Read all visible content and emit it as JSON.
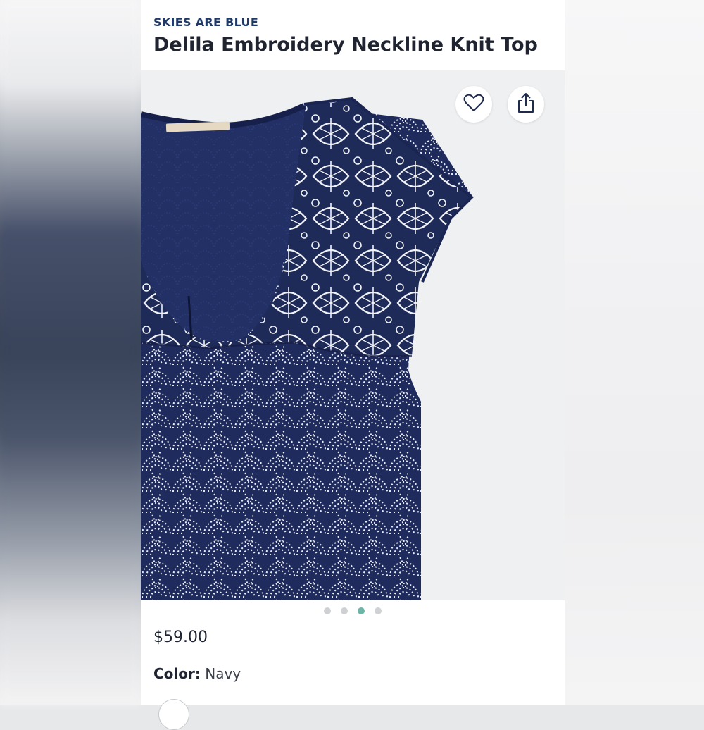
{
  "brand": "SKIES ARE BLUE",
  "product_title": "Delila Embroidery Neckline Knit Top",
  "icons": {
    "favorite": "heart-icon",
    "share": "share-icon"
  },
  "carousel": {
    "total": 4,
    "active": 3
  },
  "price": "$59.00",
  "color": {
    "label": "Color:",
    "value": "Navy"
  },
  "colors": {
    "navy": "#1e2a57",
    "accent": "#6cb6a8",
    "brand_text": "#1f3a66"
  }
}
